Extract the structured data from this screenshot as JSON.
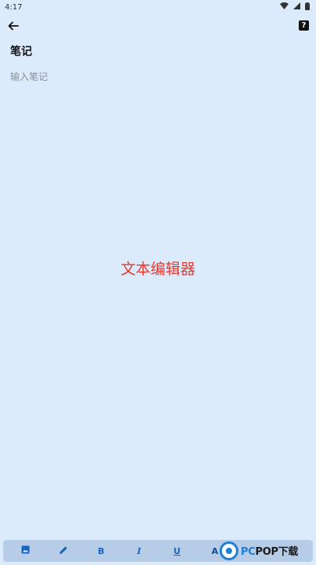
{
  "status_bar": {
    "time": "4:17",
    "icons": [
      "wifi-icon",
      "signal-icon",
      "battery-icon"
    ]
  },
  "top_bar": {
    "back_icon": "arrow-left-icon",
    "help_label": "?"
  },
  "note": {
    "title": "笔记",
    "placeholder": "输入笔记",
    "value": ""
  },
  "overlay_label": "文本编辑器",
  "toolbar": {
    "tools": [
      {
        "name": "image-icon",
        "label": ""
      },
      {
        "name": "pen-icon",
        "label": ""
      },
      {
        "name": "bold-button",
        "label": "B"
      },
      {
        "name": "italic-button",
        "label": "I"
      },
      {
        "name": "underline-button",
        "label": "U"
      },
      {
        "name": "font-color-button",
        "label": "A"
      }
    ]
  },
  "watermark": {
    "brand_blue": "PC",
    "brand_dark": "POP下载"
  },
  "colors": {
    "background": "#dcebfb",
    "toolbar": "#b7cce6",
    "accent": "#1565c0",
    "overlay_text": "#e23a2e"
  }
}
